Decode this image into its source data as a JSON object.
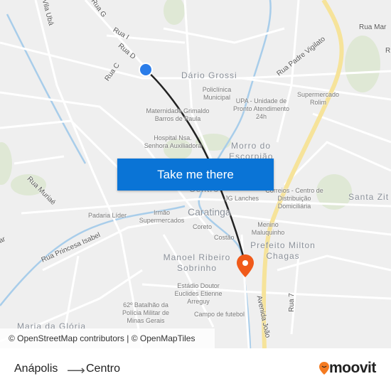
{
  "map": {
    "streets": [
      "Vila Ubá",
      "Rua G",
      "Rua I",
      "Rua D",
      "Rua C",
      "Rua Padre Vigilato",
      "Rua Mar",
      "Rua Muriaé",
      "Rua Princesa Isabel",
      "Avenida João",
      "Rua 7",
      "tar",
      "R"
    ],
    "neighborhoods": [
      "Dário Grossi",
      "Morro do Escorpião",
      "Centro",
      "Santa Zit",
      "Prefeito Milton Chagas",
      "Manoel Ribeiro Sobrinho",
      "Maria da Glória"
    ],
    "city": "Caratinga",
    "pois": [
      "Policlínica Municipal",
      "UPA - Unidade de Pronto Atendimento 24h",
      "Supermercado Rolim",
      "Maternidade Grimaldo Barros de Paula",
      "Hospital Nsa. Senhora Auxiliadora",
      "JG Lanches",
      "Correios - Centro de Distribuição Domiciliária",
      "Padaria Líder",
      "Irmão Supermercados",
      "Coreto",
      "Costão",
      "Menino Maluquinho",
      "Estádio Doutor Euclides Etienne Arreguy",
      "62º Batalhão da Polícia Militar de Minas Gerais",
      "Campo de futebol"
    ],
    "attribution": "© OpenStreetMap contributors | © OpenMapTiles",
    "origin_color": "#2b7de9",
    "destination_color": "#f05a1a",
    "route_color": "#222222"
  },
  "cta": {
    "label": "Take me there",
    "color": "#0a74d6"
  },
  "footer": {
    "from": "Anápolis",
    "to": "Centro",
    "arrow_icon": "arrow-right-icon",
    "brand": "moovit",
    "brand_color": "#f47a20"
  }
}
